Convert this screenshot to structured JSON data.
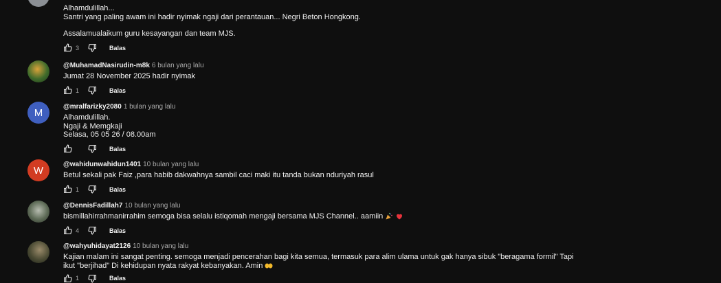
{
  "reply_label": "Balas",
  "comments": [
    {
      "lines": [
        "Alhamdulillah...",
        "Santri yang paling awam ini hadir nyimak ngaji dari perantauan... Negri Beton Hongkong.",
        "",
        "Assalamualaikum guru kesayangan dan team MJS."
      ],
      "likes": "3"
    },
    {
      "author": "@MuhamadNasirudin-m8k",
      "time": "6 bulan yang lalu",
      "lines": [
        "Jumat 28 November 2025 hadir nyimak"
      ],
      "likes": "1"
    },
    {
      "author": "@mralfarizky2080",
      "time": "1 bulan yang lalu",
      "avatar_letter": "M",
      "avatar_color": "#3f5fbf",
      "lines": [
        "Alhamdulillah.",
        "Ngaji & Memgkaji",
        "Selasa, 05 05 26 / 08.00am"
      ],
      "likes": ""
    },
    {
      "author": "@wahidunwahidun1401",
      "time": "10 bulan yang lalu",
      "avatar_letter": "W",
      "avatar_color": "#d23c22",
      "lines": [
        "Betul sekali pak Faiz ,para habib dakwahnya sambil caci maki itu tanda bukan nduriyah rasul"
      ],
      "likes": "1"
    },
    {
      "author": "@DennisFadillah7",
      "time": "10 bulan yang lalu",
      "lines": [
        "bismillahirrahmanirrahim semoga bisa selalu istiqomah mengaji bersama MJS Channel.. aamiin"
      ],
      "likes": "4"
    },
    {
      "author": "@wahyuhidayat2126",
      "time": "10 bulan yang lalu",
      "lines": [
        "Kajian malam ini sangat penting. semoga menjadi pencerahan bagi kita semua, termasuk para alim ulama untuk gak hanya sibuk \"beragama formil\" Tapi",
        "ikut \"berjihad\" Di kehidupan nyata rakyat kebanyakan. Amin"
      ],
      "likes": "1"
    }
  ]
}
